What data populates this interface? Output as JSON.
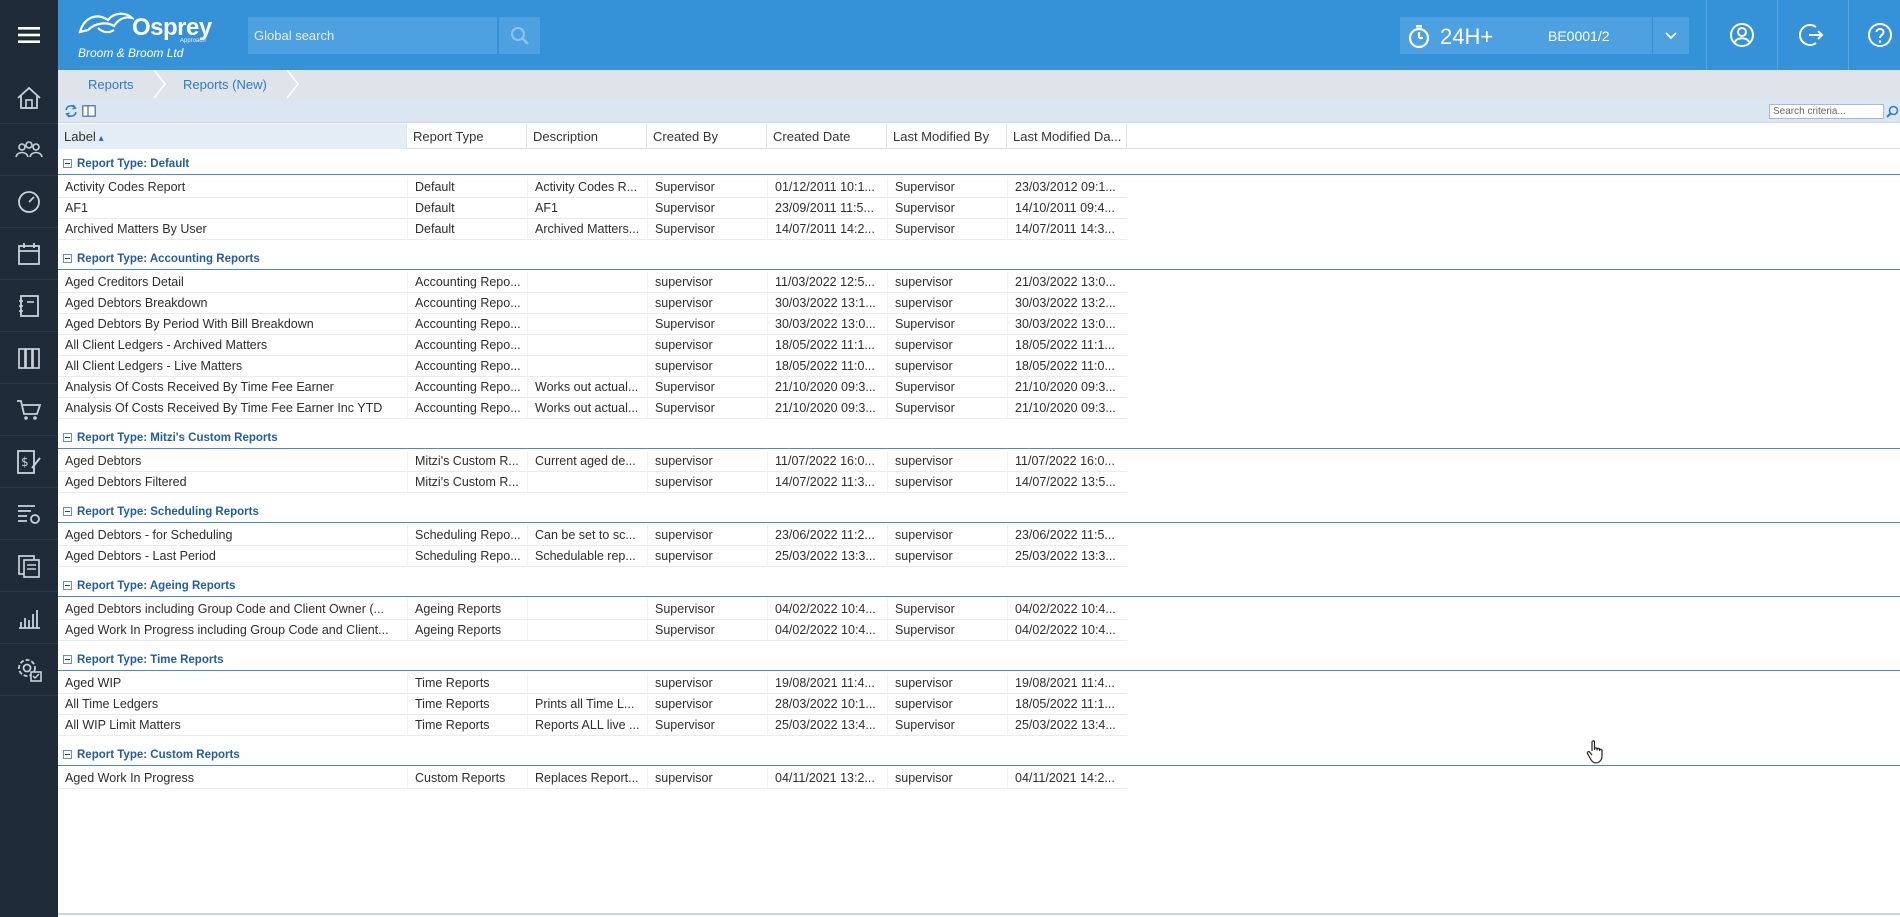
{
  "header": {
    "brand": "Osprey",
    "brand_tag": "Approach",
    "company": "Broom & Broom Ltd",
    "search_placeholder": "Global search",
    "timer_label": "24H+",
    "timer_code": "BE0001/2"
  },
  "sidebar": {
    "items": [
      "home-icon",
      "people-icon",
      "dashboard-icon",
      "calendar-icon",
      "notebook-icon",
      "library-icon",
      "cart-icon",
      "billing-icon",
      "settings-list-icon",
      "documents-icon",
      "reports-chart-icon",
      "admin-gear-icon"
    ]
  },
  "breadcrumb": {
    "items": [
      "Reports",
      "Reports (New)"
    ]
  },
  "toolbar": {
    "search_placeholder": "Search criteria..."
  },
  "grid": {
    "columns": [
      {
        "label": "Label",
        "sorted": "asc"
      },
      {
        "label": "Report Type"
      },
      {
        "label": "Description"
      },
      {
        "label": "Created By"
      },
      {
        "label": "Created Date"
      },
      {
        "label": "Last Modified By"
      },
      {
        "label": "Last Modified Da..."
      }
    ],
    "groups": [
      {
        "title": "Report Type: Default",
        "rows": [
          [
            "Activity Codes Report",
            "Default",
            "Activity Codes R...",
            "Supervisor",
            "01/12/2011 10:1...",
            "Supervisor",
            "23/03/2012 09:1..."
          ],
          [
            "AF1",
            "Default",
            "AF1",
            "Supervisor",
            "23/09/2011 11:5...",
            "Supervisor",
            "14/10/2011 09:4..."
          ],
          [
            "Archived Matters By User",
            "Default",
            "Archived Matters...",
            "Supervisor",
            "14/07/2011 14:2...",
            "Supervisor",
            "14/07/2011 14:3..."
          ]
        ]
      },
      {
        "title": "Report Type: Accounting Reports",
        "rows": [
          [
            "Aged Creditors Detail",
            "Accounting Repo...",
            "",
            "supervisor",
            "11/03/2022 12:5...",
            "supervisor",
            "21/03/2022 13:0..."
          ],
          [
            "Aged Debtors Breakdown",
            "Accounting Repo...",
            "",
            "supervisor",
            "30/03/2022 13:1...",
            "supervisor",
            "30/03/2022 13:2..."
          ],
          [
            "Aged Debtors By Period With Bill Breakdown",
            "Accounting Repo...",
            "",
            "Supervisor",
            "30/03/2022 13:0...",
            "Supervisor",
            "30/03/2022 13:0..."
          ],
          [
            "All Client Ledgers - Archived Matters",
            "Accounting Repo...",
            "",
            "supervisor",
            "18/05/2022 11:1...",
            "supervisor",
            "18/05/2022 11:1..."
          ],
          [
            "All Client Ledgers - Live Matters",
            "Accounting Repo...",
            "",
            "supervisor",
            "18/05/2022 11:0...",
            "supervisor",
            "18/05/2022 11:0..."
          ],
          [
            "Analysis Of Costs Received By Time Fee Earner",
            "Accounting Repo...",
            "Works out actual...",
            "Supervisor",
            "21/10/2020 09:3...",
            "Supervisor",
            "21/10/2020 09:3..."
          ],
          [
            "Analysis Of Costs Received By Time Fee Earner Inc YTD",
            "Accounting Repo...",
            "Works out actual...",
            "Supervisor",
            "21/10/2020 09:3...",
            "Supervisor",
            "21/10/2020 09:3..."
          ]
        ]
      },
      {
        "title": "Report Type: Mitzi's Custom Reports",
        "rows": [
          [
            "Aged Debtors",
            "Mitzi's Custom R...",
            "Current aged de...",
            "supervisor",
            "11/07/2022 16:0...",
            "supervisor",
            "11/07/2022 16:0..."
          ],
          [
            "Aged Debtors Filtered",
            "Mitzi's Custom R...",
            "",
            "supervisor",
            "14/07/2022 11:3...",
            "supervisor",
            "14/07/2022 13:5..."
          ]
        ]
      },
      {
        "title": "Report Type: Scheduling Reports",
        "rows": [
          [
            "Aged Debtors - for Scheduling",
            "Scheduling Repo...",
            "Can be set to sc...",
            "supervisor",
            "23/06/2022 11:2...",
            "supervisor",
            "23/06/2022 11:5..."
          ],
          [
            "Aged Debtors - Last Period",
            "Scheduling Repo...",
            "Schedulable rep...",
            "supervisor",
            "25/03/2022 13:3...",
            "supervisor",
            "25/03/2022 13:3..."
          ]
        ]
      },
      {
        "title": "Report Type: Ageing Reports",
        "rows": [
          [
            "Aged Debtors including Group Code and Client Owner (...",
            "Ageing Reports",
            "",
            "Supervisor",
            "04/02/2022 10:4...",
            "Supervisor",
            "04/02/2022 10:4..."
          ],
          [
            "Aged Work In Progress including Group Code and Client...",
            "Ageing Reports",
            "",
            "Supervisor",
            "04/02/2022 10:4...",
            "Supervisor",
            "04/02/2022 10:4..."
          ]
        ]
      },
      {
        "title": "Report Type: Time Reports",
        "rows": [
          [
            "Aged WIP",
            "Time Reports",
            "",
            "supervisor",
            "19/08/2021 11:4...",
            "supervisor",
            "19/08/2021 11:4..."
          ],
          [
            "All Time Ledgers",
            "Time Reports",
            "Prints all Time L...",
            "supervisor",
            "28/03/2022 10:1...",
            "supervisor",
            "18/05/2022 11:1..."
          ],
          [
            "All WIP Limit Matters",
            "Time Reports",
            "Reports ALL live ...",
            "Supervisor",
            "25/03/2022 13:4...",
            "Supervisor",
            "25/03/2022 13:4..."
          ]
        ]
      },
      {
        "title": "Report Type: Custom Reports",
        "rows": [
          [
            "Aged Work In Progress",
            "Custom Reports",
            "Replaces Report...",
            "supervisor",
            "04/11/2021 13:2...",
            "supervisor",
            "04/11/2021 14:2..."
          ]
        ]
      }
    ]
  },
  "colors": {
    "topbar": "#3592d8",
    "sidebar": "#1f2b38",
    "group_title": "#235e9a",
    "breadcrumb_link": "#2b7cc0"
  }
}
